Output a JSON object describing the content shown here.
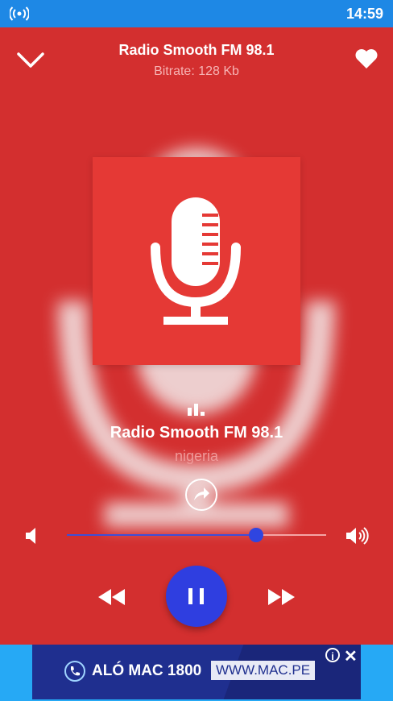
{
  "status_bar": {
    "time": "14:59",
    "signal_icon": "broadcast-icon"
  },
  "player": {
    "title": "Radio Smooth FM 98.1",
    "subtitle": "Bitrate: 128 Kb",
    "station_name": "Radio Smooth FM 98.1",
    "country": "nigeria",
    "volume_fraction": 0.73,
    "state": "playing"
  },
  "icons": {
    "collapse": "chevron-down-icon",
    "favorite": "heart-icon",
    "artwork": "microphone-icon",
    "equalizer": "equalizer-icon",
    "share": "share-icon",
    "volume_low": "volume-low-icon",
    "volume_high": "volume-high-icon",
    "rewind": "rewind-icon",
    "pause": "pause-icon",
    "fast_forward": "fast-forward-icon"
  },
  "ad": {
    "text": "ALÓ MAC 1800",
    "url": "WWW.MAC.PE",
    "info": "i",
    "close": "✕"
  },
  "colors": {
    "accent": "#2f3ee0",
    "background": "#d32f2f",
    "artwork_bg": "#e53935",
    "status_bar": "#1e88e5"
  }
}
